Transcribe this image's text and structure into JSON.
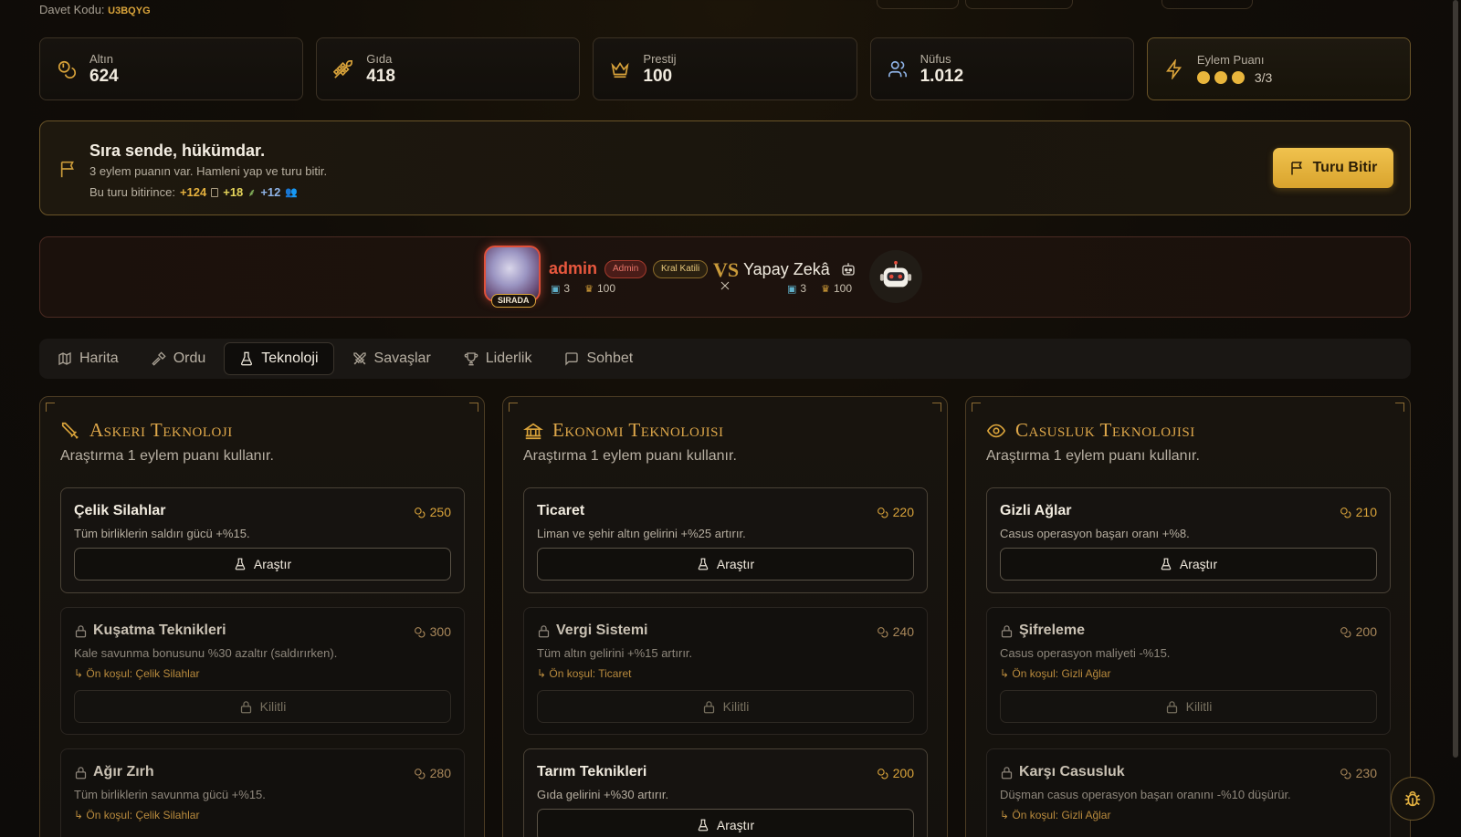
{
  "invite": {
    "label": "Davet Kodu:",
    "code": "U3BQYG"
  },
  "stats": [
    {
      "label": "Altın",
      "value": "624",
      "icon": "coins-icon"
    },
    {
      "label": "Gıda",
      "value": "418",
      "icon": "wheat-icon"
    },
    {
      "label": "Prestij",
      "value": "100",
      "icon": "crown-icon"
    },
    {
      "label": "Nüfus",
      "value": "1.012",
      "icon": "users-icon"
    },
    {
      "label": "Eylem Puanı",
      "value": "3/3",
      "icon": "lightning-icon",
      "filled": 3,
      "total": 3
    }
  ],
  "turn": {
    "title": "Sıra sende, hükümdar.",
    "subtitle": "3 eylem puanın var. Hamleni yap ve turu bitir.",
    "gain_label": "Bu turu bitirince:",
    "gold_gain": "+124",
    "food_gain": "+18",
    "pop_gain": "+12",
    "end_button": "Turu Bitir"
  },
  "versus": {
    "player": {
      "name": "admin",
      "badge_role": "Admin",
      "badge_title": "Kral Katili",
      "turn_tag": "SIRADA",
      "territories": "3",
      "prestige": "100"
    },
    "vs_label": "VS",
    "opponent": {
      "name": "Yapay Zekâ",
      "territories": "3",
      "prestige": "100"
    }
  },
  "tabs": [
    {
      "label": "Harita",
      "icon": "map-icon",
      "active": false
    },
    {
      "label": "Ordu",
      "icon": "hammer-icon",
      "active": false
    },
    {
      "label": "Teknoloji",
      "icon": "flask-icon",
      "active": true
    },
    {
      "label": "Savaşlar",
      "icon": "crossed-swords-icon",
      "active": false
    },
    {
      "label": "Liderlik",
      "icon": "trophy-icon",
      "active": false
    },
    {
      "label": "Sohbet",
      "icon": "chat-icon",
      "active": false
    }
  ],
  "research_note": "Araştırma 1 eylem puanı kullanır.",
  "research_button": "Araştır",
  "locked_button": "Kilitli",
  "prereq_prefix": "Ön koşul:",
  "columns": [
    {
      "title": "Askeri Teknoloji",
      "icon": "sword-icon",
      "techs": [
        {
          "name": "Çelik Silahlar",
          "cost": "250",
          "desc": "Tüm birliklerin saldırı gücü +%15.",
          "locked": false,
          "prereq": ""
        },
        {
          "name": "Kuşatma Teknikleri",
          "cost": "300",
          "desc": "Kale savunma bonusunu %30 azaltır (saldırırken).",
          "locked": true,
          "prereq": "Çelik Silahlar"
        },
        {
          "name": "Ağır Zırh",
          "cost": "280",
          "desc": "Tüm birliklerin savunma gücü +%15.",
          "locked": true,
          "prereq": "Çelik Silahlar"
        }
      ]
    },
    {
      "title": "Ekonomi Teknolojisi",
      "icon": "bank-icon",
      "techs": [
        {
          "name": "Ticaret",
          "cost": "220",
          "desc": "Liman ve şehir altın gelirini +%25 artırır.",
          "locked": false,
          "prereq": ""
        },
        {
          "name": "Vergi Sistemi",
          "cost": "240",
          "desc": "Tüm altın gelirini +%15 artırır.",
          "locked": true,
          "prereq": "Ticaret"
        },
        {
          "name": "Tarım Teknikleri",
          "cost": "200",
          "desc": "Gıda gelirini +%30 artırır.",
          "locked": false,
          "prereq": ""
        }
      ]
    },
    {
      "title": "Casusluk Teknolojisi",
      "icon": "eye-icon",
      "techs": [
        {
          "name": "Gizli Ağlar",
          "cost": "210",
          "desc": "Casus operasyon başarı oranı +%8.",
          "locked": false,
          "prereq": ""
        },
        {
          "name": "Şifreleme",
          "cost": "200",
          "desc": "Casus operasyon maliyeti -%15.",
          "locked": true,
          "prereq": "Gizli Ağlar"
        },
        {
          "name": "Karşı Casusluk",
          "cost": "230",
          "desc": "Düşman casus operasyon başarı oranını -%10 düşürür.",
          "locked": true,
          "prereq": "Gizli Ağlar"
        }
      ]
    }
  ],
  "colors": {
    "accent": "#d9a33a",
    "danger": "#e8583e",
    "bg": "#110d08"
  }
}
